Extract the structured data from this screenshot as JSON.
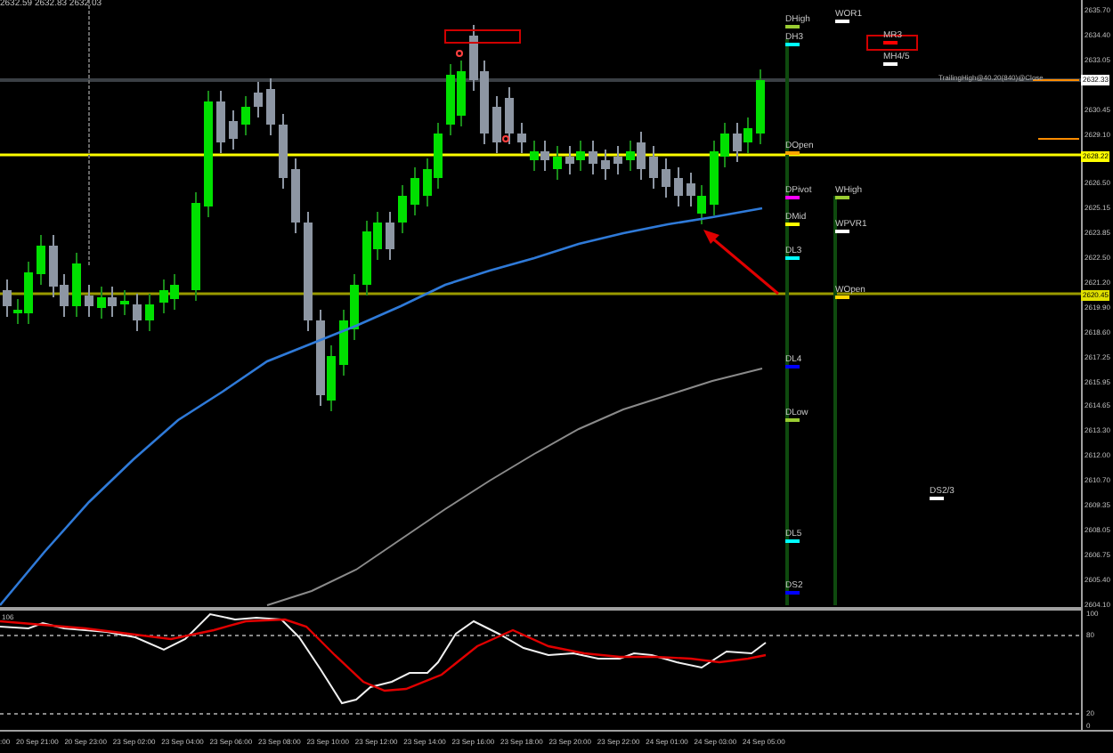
{
  "header": "2632.59 2632.83 2632.03",
  "price_axis": [
    "2635.70",
    "2634.40",
    "2633.05",
    "2630.45",
    "2629.10",
    "2626.50",
    "2625.15",
    "2623.85",
    "2622.50",
    "2621.20",
    "2619.90",
    "2618.60",
    "2617.25",
    "2615.95",
    "2614.65",
    "2613.30",
    "2612.00",
    "2610.70",
    "2609.35",
    "2608.05",
    "2606.75",
    "2605.40",
    "2604.10"
  ],
  "price_markers": [
    {
      "label": "2632.33",
      "color": "#ffffff"
    },
    {
      "label": "2628.22",
      "color": "#ffff00"
    },
    {
      "label": "2620.45",
      "color": "#e0e000"
    }
  ],
  "level_labels": [
    {
      "label": "DHigh",
      "color": "#9acd32"
    },
    {
      "label": "DH3",
      "color": "#00ffff"
    },
    {
      "label": "WOR1",
      "color": "#ffffff"
    },
    {
      "label": "MR3",
      "color": "#ff0000"
    },
    {
      "label": "MH4/5",
      "color": "#ffffff"
    },
    {
      "label": "DOpen",
      "color": "#ffa500"
    },
    {
      "label": "DPivot",
      "color": "#ff00ff"
    },
    {
      "label": "WHigh",
      "color": "#9acd32"
    },
    {
      "label": "DMid",
      "color": "#ffff00"
    },
    {
      "label": "WPVR1",
      "color": "#ffffff"
    },
    {
      "label": "DL3",
      "color": "#00ffff"
    },
    {
      "label": "WOpen",
      "color": "#ffd700"
    },
    {
      "label": "DL4",
      "color": "#0000ff"
    },
    {
      "label": "DLow",
      "color": "#9acd32"
    },
    {
      "label": "DS2/3",
      "color": "#ffffff"
    },
    {
      "label": "DL5",
      "color": "#00ffff"
    },
    {
      "label": "DS2",
      "color": "#0000ff"
    }
  ],
  "trailing_note": "TrailingHigh@40.20(840)@Close",
  "indicator": {
    "label": "106",
    "axis": [
      "100",
      "80",
      "20",
      "0"
    ]
  },
  "time_axis": [
    ":00",
    "20 Sep 21:00",
    "20 Sep 23:00",
    "23 Sep 02:00",
    "23 Sep 04:00",
    "23 Sep 06:00",
    "23 Sep 08:00",
    "23 Sep 10:00",
    "23 Sep 12:00",
    "23 Sep 14:00",
    "23 Sep 16:00",
    "23 Sep 18:00",
    "23 Sep 20:00",
    "23 Sep 22:00",
    "24 Sep 01:00",
    "24 Sep 03:00",
    "24 Sep 05:00"
  ]
}
